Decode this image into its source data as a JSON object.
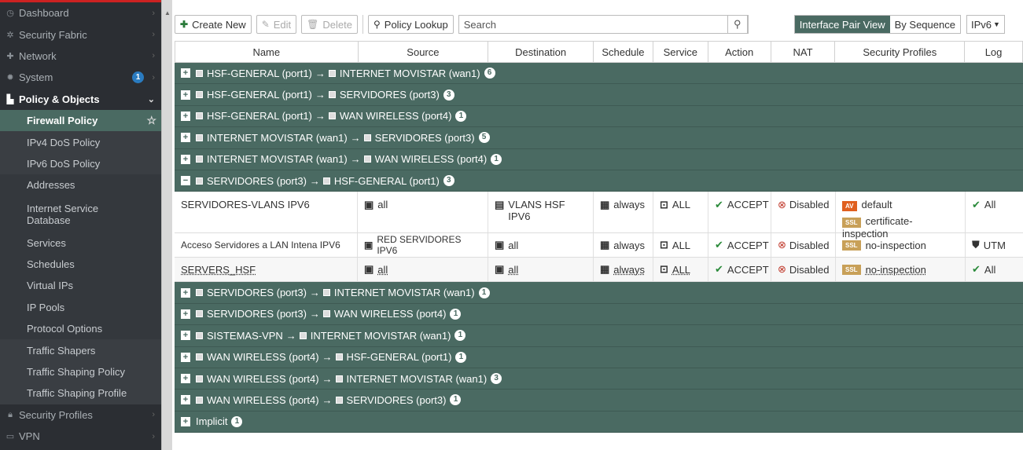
{
  "sidebar": {
    "items": [
      {
        "label": "Dashboard",
        "icon": "dashboard-icon"
      },
      {
        "label": "Security Fabric",
        "icon": "fabric-icon"
      },
      {
        "label": "Network",
        "icon": "network-icon"
      },
      {
        "label": "System",
        "icon": "gear-icon",
        "badge": "1"
      },
      {
        "label": "Policy & Objects",
        "icon": "policy-icon"
      }
    ],
    "subitems": [
      "Firewall Policy",
      "IPv4 DoS Policy",
      "IPv6 DoS Policy",
      "Addresses",
      "Internet Service Database",
      "Services",
      "Schedules",
      "Virtual IPs",
      "IP Pools",
      "Protocol Options",
      "Traffic Shapers",
      "Traffic Shaping Policy",
      "Traffic Shaping Profile"
    ],
    "bottom": [
      {
        "label": "Security Profiles",
        "icon": "lock-icon"
      },
      {
        "label": "VPN",
        "icon": "monitor-icon"
      }
    ]
  },
  "toolbar": {
    "create": "Create New",
    "edit": "Edit",
    "delete": "Delete",
    "lookup": "Policy Lookup",
    "search_placeholder": "Search",
    "view_pair": "Interface Pair View",
    "view_seq": "By Sequence",
    "ip": "IPv6"
  },
  "columns": [
    "Name",
    "Source",
    "Destination",
    "Schedule",
    "Service",
    "Action",
    "NAT",
    "Security Profiles",
    "Log"
  ],
  "groups_top": [
    {
      "src": "HSF-GENERAL (port1)",
      "dst": "INTERNET MOVISTAR (wan1)",
      "count": "6"
    },
    {
      "src": "HSF-GENERAL (port1)",
      "dst": "SERVIDORES (port3)",
      "count": "3"
    },
    {
      "src": "HSF-GENERAL (port1)",
      "dst": "WAN WIRELESS (port4)",
      "count": "1"
    },
    {
      "src": "INTERNET MOVISTAR (wan1)",
      "dst": "SERVIDORES (port3)",
      "count": "5"
    },
    {
      "src": "INTERNET MOVISTAR (wan1)",
      "dst": "WAN WIRELESS (port4)",
      "count": "1"
    },
    {
      "src": "SERVIDORES (port3)",
      "dst": "HSF-GENERAL (port1)",
      "count": "3"
    }
  ],
  "rows": [
    {
      "name": "SERVIDORES-VLANS IPV6",
      "source": "all",
      "destination": "VLANS HSF IPV6",
      "schedule": "always",
      "service": "ALL",
      "action": "ACCEPT",
      "nat": "Disabled",
      "profile1": "default",
      "profile2": "certificate-inspection",
      "log": "All"
    },
    {
      "name": "Acceso Servidores a LAN Intena IPV6",
      "source": "RED SERVIDORES IPV6",
      "destination": "all",
      "schedule": "always",
      "service": "ALL",
      "action": "ACCEPT",
      "nat": "Disabled",
      "profile1": "no-inspection",
      "log": "UTM"
    },
    {
      "name": "SERVERS_HSF",
      "source": "all",
      "destination": "all",
      "schedule": "always",
      "service": "ALL",
      "action": "ACCEPT",
      "nat": "Disabled",
      "profile1": "no-inspection",
      "log": "All"
    }
  ],
  "groups_bottom": [
    {
      "src": "SERVIDORES (port3)",
      "dst": "INTERNET MOVISTAR (wan1)",
      "count": "1"
    },
    {
      "src": "SERVIDORES (port3)",
      "dst": "WAN WIRELESS (port4)",
      "count": "1"
    },
    {
      "src": "SISTEMAS-VPN",
      "dst": "INTERNET MOVISTAR (wan1)",
      "count": "1"
    },
    {
      "src": "WAN WIRELESS (port4)",
      "dst": "HSF-GENERAL (port1)",
      "count": "1"
    },
    {
      "src": "WAN WIRELESS (port4)",
      "dst": "INTERNET MOVISTAR (wan1)",
      "count": "3"
    },
    {
      "src": "WAN WIRELESS (port4)",
      "dst": "SERVIDORES (port3)",
      "count": "1"
    }
  ],
  "implicit": {
    "label": "Implicit",
    "count": "1"
  },
  "tags": {
    "av": "AV",
    "ssl": "SSL"
  }
}
